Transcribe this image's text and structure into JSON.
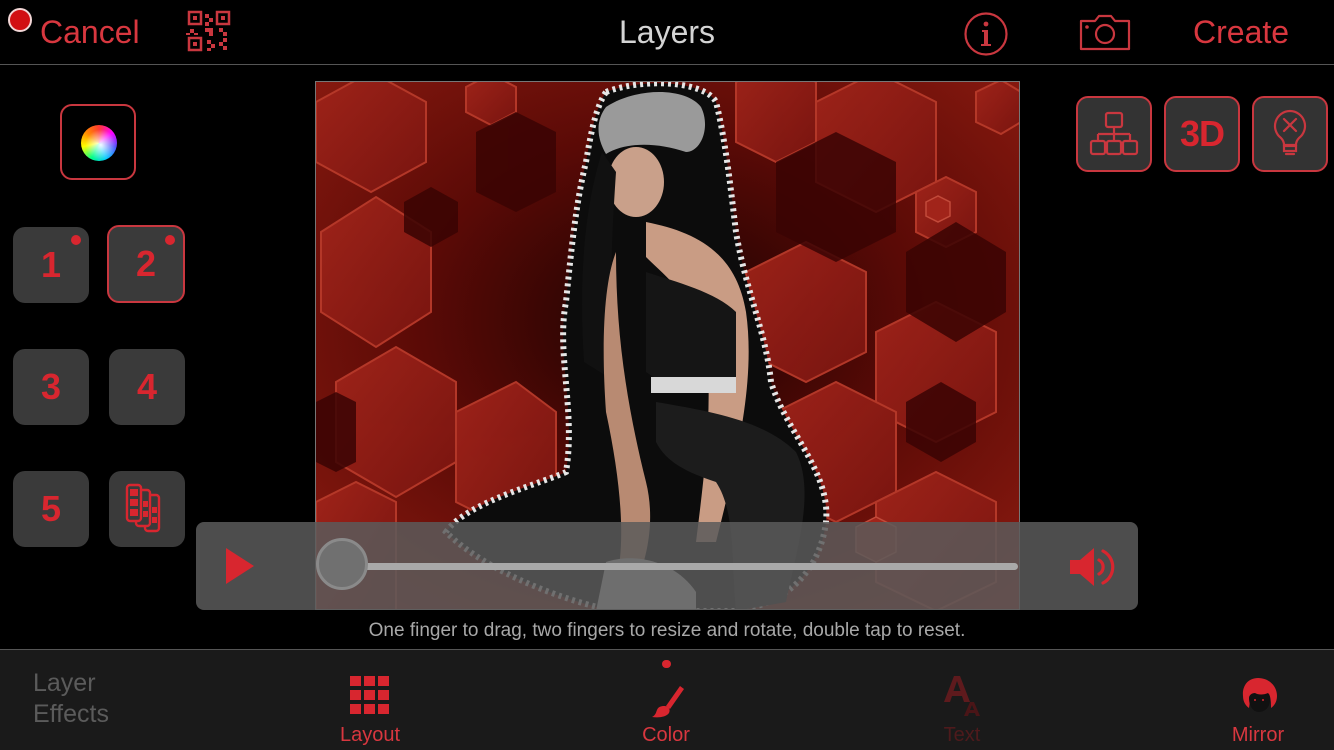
{
  "topbar": {
    "recording_indicator": "record-dot",
    "cancel_label": "Cancel",
    "qr_icon": "qr-code-icon",
    "title": "Layers",
    "info_icon": "info-icon",
    "camera_icon": "camera-icon",
    "create_label": "Create"
  },
  "left_tools": {
    "color_wheel_icon": "color-wheel-icon",
    "layers": [
      {
        "label": "1",
        "has_content_dot": true,
        "active": false
      },
      {
        "label": "2",
        "has_content_dot": true,
        "active": true
      },
      {
        "label": "3",
        "has_content_dot": false,
        "active": false
      },
      {
        "label": "4",
        "has_content_dot": false,
        "active": false
      },
      {
        "label": "5",
        "has_content_dot": false,
        "active": false
      }
    ],
    "layer_stack_icon": "layer-stack-icon"
  },
  "right_tools": {
    "hierarchy_icon": "hierarchy-icon",
    "three_d_label": "3D",
    "bulb_off_icon": "lightbulb-off-icon"
  },
  "canvas": {
    "description": "Person in grey beanie cut out over red hexagon background"
  },
  "player": {
    "play_icon": "play-icon",
    "progress": 0.0,
    "volume_icon": "speaker-icon"
  },
  "hint": "One finger to drag, two fingers to resize and rotate, double tap to reset.",
  "tabbar": {
    "layer_effects": [
      "Layer",
      "Effects"
    ],
    "tabs": [
      {
        "label": "Layout",
        "icon": "grid-icon",
        "color": "#d8262f"
      },
      {
        "label": "Color",
        "icon": "paintbrush-icon",
        "color": "#d8262f",
        "badge_dot": true
      },
      {
        "label": "Text",
        "icon": "text-size-icon",
        "color": "#5a1a1c"
      },
      {
        "label": "Mirror",
        "icon": "face-icon",
        "color": "#d8262f"
      }
    ]
  },
  "colors": {
    "accent": "#d8373f",
    "accent_strong": "#d8262f",
    "button_bg": "#3a3a3a",
    "tabbar_bg": "#1a1a1a",
    "title_text": "#d4d4d4",
    "hint_text": "#a8a8a8"
  }
}
